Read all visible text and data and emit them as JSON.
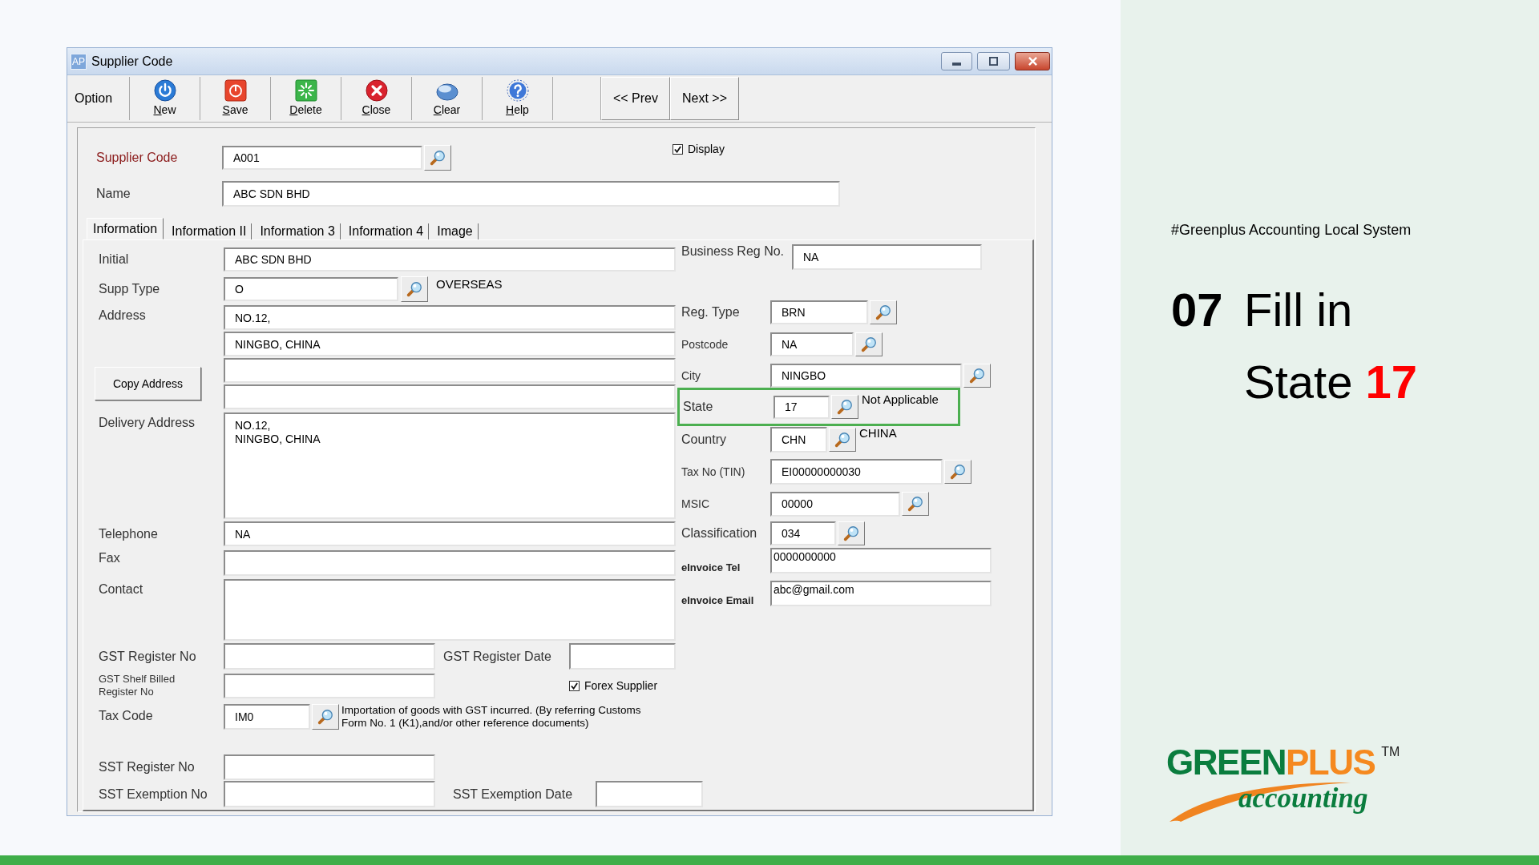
{
  "window": {
    "app_badge": "AP",
    "title": "Supplier Code"
  },
  "toolbar": {
    "label": "Option",
    "buttons": [
      {
        "kind": "new",
        "label": "New"
      },
      {
        "kind": "save",
        "label": "Save"
      },
      {
        "kind": "delete",
        "label": "Delete"
      },
      {
        "kind": "close",
        "label": "Close"
      },
      {
        "kind": "clear",
        "label": "Clear"
      },
      {
        "kind": "help",
        "label": "Help"
      }
    ],
    "navigation": [
      {
        "label": "<< Prev"
      },
      {
        "label": "Next >>"
      }
    ]
  },
  "header": {
    "supplier_code": {
      "label": "Supplier Code",
      "value": "A001",
      "lookup": true
    },
    "display": {
      "label": "Display",
      "checked": true
    },
    "name": {
      "label": "Name",
      "value": "ABC SDN BHD"
    }
  },
  "tabs": [
    {
      "label": "Information",
      "selected": true
    },
    {
      "label": "Information II",
      "selected": false
    },
    {
      "label": "Information 3",
      "selected": false
    },
    {
      "label": "Information 4",
      "selected": false
    },
    {
      "label": "Image",
      "selected": false
    }
  ],
  "information": {
    "initial": {
      "label": "Initial",
      "value": "ABC SDN BHD"
    },
    "supp_type": {
      "label": "Supp Type",
      "value": "O",
      "lookup": true,
      "description": "OVERSEAS"
    },
    "address": {
      "label": "Address",
      "line_1": "NO.12,",
      "line_2": "NINGBO, CHINA"
    },
    "copy_address_button": "Copy Address",
    "delivery_address": {
      "label": "Delivery Address",
      "value": "NO.12,\nNINGBO, CHINA"
    },
    "telephone": {
      "label": "Telephone",
      "value": "NA"
    },
    "fax": {
      "label": "Fax"
    },
    "contact": {
      "label": "Contact"
    },
    "right_column": {
      "business_reg_no": {
        "label": "Business Reg No.",
        "value": "NA"
      },
      "reg_type": {
        "label": "Reg. Type",
        "value": "BRN",
        "lookup": true
      },
      "postcode": {
        "label": "Postcode",
        "value": "NA",
        "lookup": true
      },
      "city": {
        "label": "City",
        "value": "NINGBO",
        "lookup": true
      },
      "state": {
        "label": "State",
        "value": "17",
        "lookup": true,
        "description": "Not Applicable",
        "highlighted": true
      },
      "country": {
        "label": "Country",
        "value": "CHN",
        "lookup": true,
        "description": "CHINA"
      },
      "tax_no": {
        "label": "Tax No (TIN)",
        "value": "EI00000000030",
        "lookup": true
      },
      "msic": {
        "label": "MSIC",
        "value": "00000",
        "lookup": true
      },
      "classification": {
        "label": "Classification",
        "value": "034",
        "lookup": true
      },
      "einvoice_tel": {
        "label": "eInvoice Tel",
        "value": "0000000000"
      },
      "einvoice_email": {
        "label": "eInvoice Email",
        "value": "abc@gmail.com"
      }
    },
    "gst_register_no": {
      "label": "GST Register No"
    },
    "gst_register_date": {
      "label": "GST Register Date"
    },
    "gst_shelf_billed_register_no": {
      "label": "GST Shelf Billed Register No"
    },
    "forex_supplier": {
      "label": "Forex Supplier",
      "checked": true
    },
    "tax_code": {
      "label": "Tax Code",
      "value": "IM0",
      "lookup": true,
      "description": "Importation of goods with GST incurred. (By referring Customs Form No. 1 (K1),and/or other reference documents)"
    },
    "sst_register_no": {
      "label": "SST Register No"
    },
    "sst_exemption_no": {
      "label": "SST Exemption No"
    },
    "sst_exemption_date": {
      "label": "SST Exemption Date"
    }
  },
  "slide": {
    "hashtag": "#Greenplus Accounting Local System",
    "step": "07",
    "lines": [
      "Fill in",
      "State **17**"
    ],
    "logo": {
      "wordmark": [
        {
          "text": "GREEN",
          "color": "#0a7d3e"
        },
        {
          "text": "PLUS",
          "color": "#f5891f"
        }
      ],
      "trademark": "TM",
      "tagline": "accounting"
    }
  }
}
